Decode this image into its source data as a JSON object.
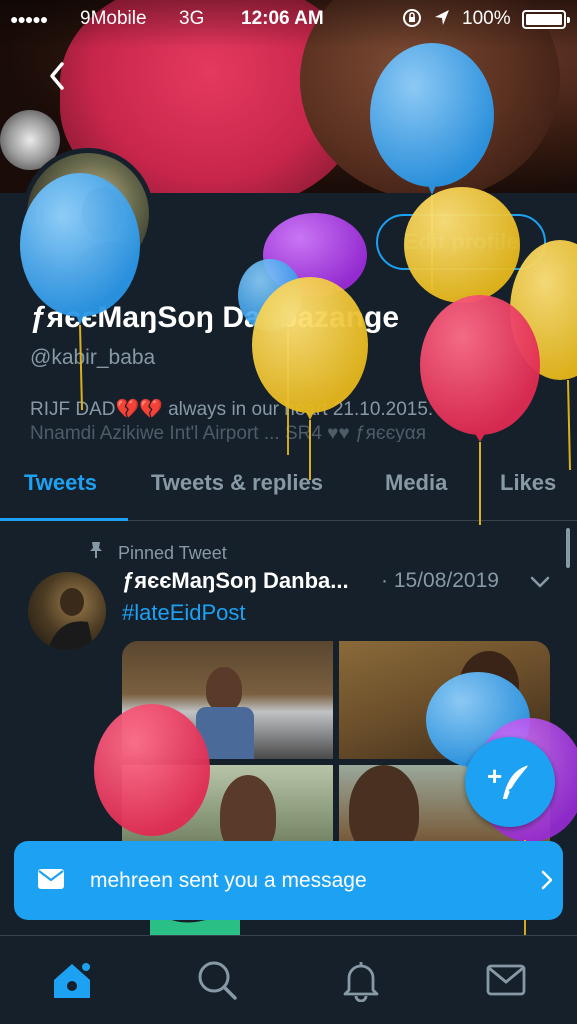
{
  "status_bar": {
    "signal": "●●●●●",
    "carrier": "9Mobile",
    "network": "3G",
    "time": "12:06 AM",
    "battery_percent": "100%"
  },
  "profile": {
    "edit_profile_label": "Edit profile",
    "display_name": "ƒяєєMaŋSoŋ Danbazange",
    "handle": "@kabir_baba",
    "bio_line1": "RIJF DAD💔💔  always in our heart 21.10.2015.",
    "bio_line2": "Nnamdi Azikiwe Int'l Airport ... SR4 ♥♥ ƒяєєуαя"
  },
  "tabs": [
    {
      "label": "Tweets",
      "active": true
    },
    {
      "label": "Tweets & replies",
      "active": false
    },
    {
      "label": "Media",
      "active": false
    },
    {
      "label": "Likes",
      "active": false
    }
  ],
  "tweet": {
    "pinned_label": "Pinned Tweet",
    "author_name": "ƒяєєMaŋSoŋ Danba...",
    "date": "· 15/08/2019",
    "hashtag": "#lateEidPost"
  },
  "toast": {
    "message": "mehreen sent you a message"
  },
  "colors": {
    "background": "#15202b",
    "accent": "#1da1f2",
    "muted_text": "#8899a6",
    "divider": "#38444d"
  },
  "icons": {
    "back": "chevron-left-icon",
    "pin": "pin-icon",
    "tweet_menu": "chevron-down-icon",
    "compose": "compose-tweet-icon",
    "toast": "envelope-icon",
    "nav": [
      "home-icon",
      "search-icon",
      "notifications-icon",
      "messages-icon"
    ]
  }
}
